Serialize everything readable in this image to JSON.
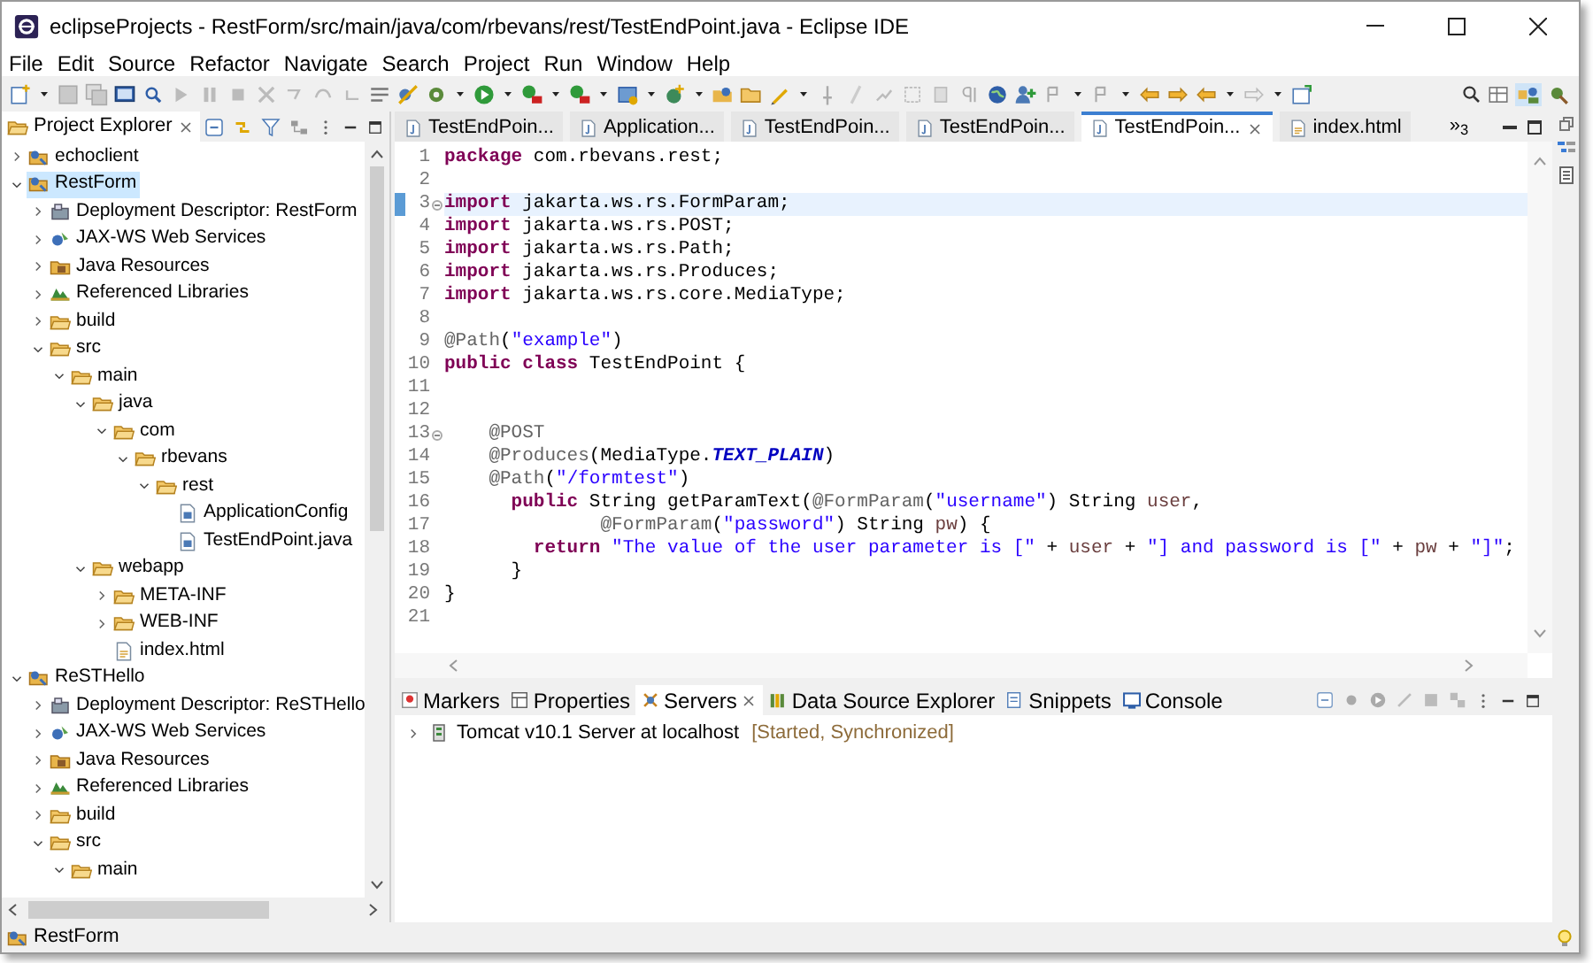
{
  "window": {
    "title": "eclipseProjects - RestForm/src/main/java/com/rbevans/rest/TestEndPoint.java - Eclipse IDE"
  },
  "menu": [
    "File",
    "Edit",
    "Source",
    "Refactor",
    "Navigate",
    "Search",
    "Project",
    "Run",
    "Window",
    "Help"
  ],
  "project_explorer": {
    "title": "Project Explorer",
    "tree": [
      {
        "label": "echoclient",
        "kind": "project",
        "expanded": false,
        "selected": false
      },
      {
        "label": "RestForm",
        "kind": "project",
        "expanded": true,
        "selected": true,
        "children": [
          {
            "label": "Deployment Descriptor: RestForm",
            "kind": "descriptor",
            "expanded": false,
            "selected": false
          },
          {
            "label": "JAX-WS Web Services",
            "kind": "webservices",
            "expanded": false,
            "selected": false
          },
          {
            "label": "Java Resources",
            "kind": "java-resources",
            "expanded": false,
            "selected": false
          },
          {
            "label": "Referenced Libraries",
            "kind": "libraries",
            "expanded": false,
            "selected": false
          },
          {
            "label": "build",
            "kind": "folder",
            "expanded": false,
            "selected": false
          },
          {
            "label": "src",
            "kind": "folder",
            "expanded": true,
            "selected": false,
            "children": [
              {
                "label": "main",
                "kind": "folder",
                "expanded": true,
                "selected": false,
                "children": [
                  {
                    "label": "java",
                    "kind": "folder",
                    "expanded": true,
                    "selected": false,
                    "children": [
                      {
                        "label": "com",
                        "kind": "folder",
                        "expanded": true,
                        "selected": false,
                        "children": [
                          {
                            "label": "rbevans",
                            "kind": "folder",
                            "expanded": true,
                            "selected": false,
                            "children": [
                              {
                                "label": "rest",
                                "kind": "folder",
                                "expanded": true,
                                "selected": false,
                                "children": [
                                  {
                                    "label": "ApplicationConfig",
                                    "kind": "java-file",
                                    "selected": false
                                  },
                                  {
                                    "label": "TestEndPoint.java",
                                    "kind": "java-file",
                                    "selected": false
                                  }
                                ]
                              }
                            ]
                          }
                        ]
                      }
                    ]
                  },
                  {
                    "label": "webapp",
                    "kind": "folder",
                    "expanded": true,
                    "selected": false,
                    "children": [
                      {
                        "label": "META-INF",
                        "kind": "folder",
                        "expanded": false,
                        "selected": false
                      },
                      {
                        "label": "WEB-INF",
                        "kind": "folder",
                        "expanded": false,
                        "selected": false
                      },
                      {
                        "label": "index.html",
                        "kind": "html-file",
                        "selected": false
                      }
                    ]
                  }
                ]
              }
            ]
          }
        ]
      },
      {
        "label": "ReSTHello",
        "kind": "project",
        "expanded": true,
        "selected": false,
        "children": [
          {
            "label": "Deployment Descriptor: ReSTHello",
            "kind": "descriptor",
            "expanded": false,
            "selected": false
          },
          {
            "label": "JAX-WS Web Services",
            "kind": "webservices",
            "expanded": false,
            "selected": false
          },
          {
            "label": "Java Resources",
            "kind": "java-resources",
            "expanded": false,
            "selected": false
          },
          {
            "label": "Referenced Libraries",
            "kind": "libraries",
            "expanded": false,
            "selected": false
          },
          {
            "label": "build",
            "kind": "folder",
            "expanded": false,
            "selected": false
          },
          {
            "label": "src",
            "kind": "folder",
            "expanded": true,
            "selected": false,
            "children": [
              {
                "label": "main",
                "kind": "folder",
                "expanded": true,
                "selected": false
              }
            ]
          }
        ]
      }
    ]
  },
  "editor": {
    "tabs": [
      {
        "label": "TestEndPoin...",
        "kind": "java",
        "selected": false
      },
      {
        "label": "Application...",
        "kind": "java",
        "selected": false
      },
      {
        "label": "TestEndPoin...",
        "kind": "java",
        "selected": false
      },
      {
        "label": "TestEndPoin...",
        "kind": "java",
        "selected": false
      },
      {
        "label": "TestEndPoin...",
        "kind": "java",
        "selected": true
      },
      {
        "label": "index.html",
        "kind": "html",
        "selected": false
      }
    ],
    "overflow": "»$_{3}$",
    "lines": [
      {
        "number": "1",
        "tokens": [
          {
            "kind": "keyword",
            "text": "package"
          },
          {
            "kind": "plain",
            "text": " com.rbevans.rest;"
          }
        ]
      },
      {
        "number": "2"
      },
      {
        "number": "3",
        "foldable": true,
        "current": true,
        "tokens": [
          {
            "kind": "keyword",
            "text": "import"
          },
          {
            "kind": "plain",
            "text": " jakarta.ws.rs.FormParam;"
          }
        ]
      },
      {
        "number": "4",
        "tokens": [
          {
            "kind": "keyword",
            "text": "import"
          },
          {
            "kind": "plain",
            "text": " jakarta.ws.rs.POST;"
          }
        ]
      },
      {
        "number": "5",
        "tokens": [
          {
            "kind": "keyword",
            "text": "import"
          },
          {
            "kind": "plain",
            "text": " jakarta.ws.rs.Path;"
          }
        ]
      },
      {
        "number": "6",
        "tokens": [
          {
            "kind": "keyword",
            "text": "import"
          },
          {
            "kind": "plain",
            "text": " jakarta.ws.rs.Produces;"
          }
        ]
      },
      {
        "number": "7",
        "tokens": [
          {
            "kind": "keyword",
            "text": "import"
          },
          {
            "kind": "plain",
            "text": " jakarta.ws.rs.core.MediaType;"
          }
        ]
      },
      {
        "number": "8"
      },
      {
        "number": "9",
        "tokens": [
          {
            "kind": "annotation",
            "text": "@Path"
          },
          {
            "kind": "plain",
            "text": "("
          },
          {
            "kind": "string",
            "text": "\"example\""
          },
          {
            "kind": "plain",
            "text": ")"
          }
        ]
      },
      {
        "number": "10",
        "tokens": [
          {
            "kind": "keyword",
            "text": "public class"
          },
          {
            "kind": "plain",
            "text": " TestEndPoint {"
          }
        ]
      },
      {
        "number": "11"
      },
      {
        "number": "12"
      },
      {
        "number": "13",
        "foldable": true,
        "tokens": [
          {
            "kind": "annotation",
            "text": "    @POST"
          }
        ]
      },
      {
        "number": "14",
        "tokens": [
          {
            "kind": "annotation",
            "text": "    @Produces"
          },
          {
            "kind": "plain",
            "text": "(MediaType."
          },
          {
            "kind": "constant",
            "text": "TEXT_PLAIN"
          },
          {
            "kind": "plain",
            "text": ")"
          }
        ]
      },
      {
        "number": "15",
        "tokens": [
          {
            "kind": "annotation",
            "text": "    @Path"
          },
          {
            "kind": "plain",
            "text": "("
          },
          {
            "kind": "string",
            "text": "\"/formtest\""
          },
          {
            "kind": "plain",
            "text": ")"
          }
        ]
      },
      {
        "number": "16",
        "tokens": [
          {
            "kind": "keyword",
            "text": "      public"
          },
          {
            "kind": "plain",
            "text": " String getParamText("
          },
          {
            "kind": "annotation",
            "text": "@FormParam"
          },
          {
            "kind": "plain",
            "text": "("
          },
          {
            "kind": "string",
            "text": "\"username\""
          },
          {
            "kind": "plain",
            "text": ") String "
          },
          {
            "kind": "param",
            "text": "user"
          },
          {
            "kind": "plain",
            "text": ","
          }
        ]
      },
      {
        "number": "17",
        "tokens": [
          {
            "kind": "annotation",
            "text": "              @FormParam"
          },
          {
            "kind": "plain",
            "text": "("
          },
          {
            "kind": "string",
            "text": "\"password\""
          },
          {
            "kind": "plain",
            "text": ") String "
          },
          {
            "kind": "param",
            "text": "pw"
          },
          {
            "kind": "plain",
            "text": ") {"
          }
        ]
      },
      {
        "number": "18",
        "tokens": [
          {
            "kind": "keyword",
            "text": "        return"
          },
          {
            "kind": "string",
            "text": " \"The value of the user parameter is [\""
          },
          {
            "kind": "plain",
            "text": " + "
          },
          {
            "kind": "param",
            "text": "user"
          },
          {
            "kind": "plain",
            "text": " + "
          },
          {
            "kind": "string",
            "text": "\"] and password is [\""
          },
          {
            "kind": "plain",
            "text": " + "
          },
          {
            "kind": "param",
            "text": "pw"
          },
          {
            "kind": "plain",
            "text": " + "
          },
          {
            "kind": "string",
            "text": "\"]\""
          },
          {
            "kind": "plain",
            "text": ";"
          }
        ]
      },
      {
        "number": "19",
        "tokens": [
          {
            "kind": "plain",
            "text": "      }"
          }
        ]
      },
      {
        "number": "20",
        "tokens": [
          {
            "kind": "plain",
            "text": "}"
          }
        ]
      },
      {
        "number": "21"
      }
    ]
  },
  "bottom_panel": {
    "tabs": [
      {
        "label": "Markers",
        "kind": "markers",
        "selected": false
      },
      {
        "label": "Properties",
        "kind": "properties",
        "selected": false
      },
      {
        "label": "Servers",
        "kind": "servers",
        "selected": true
      },
      {
        "label": "Data Source Explorer",
        "kind": "data-source",
        "selected": false
      },
      {
        "label": "Snippets",
        "kind": "snippets",
        "selected": false
      },
      {
        "label": "Console",
        "kind": "console",
        "selected": false
      }
    ],
    "servers": [
      {
        "name": "Tomcat v10.1 Server at localhost",
        "status": "[Started, Synchronized]",
        "expanded": false
      }
    ]
  },
  "status_bar": {
    "text": "RestForm"
  }
}
